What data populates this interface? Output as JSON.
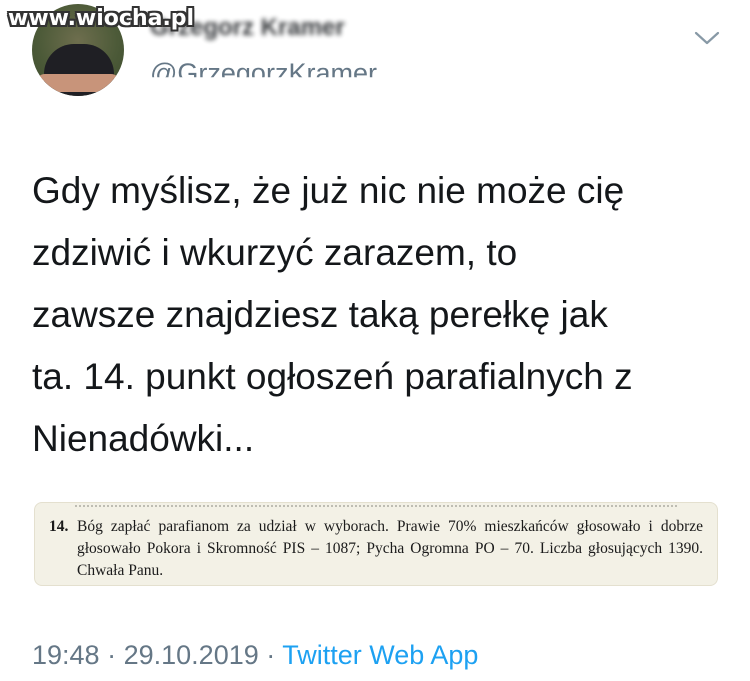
{
  "watermark": "www.wiocha.pl",
  "author": {
    "display_name": "Grzegorz Kramer",
    "handle": "@GrzegorzKramer"
  },
  "tweet": {
    "text": "Gdy myślisz, że już nic nie może cię\nzdziwić i wkurzyć zarazem, to\nzawsze znajdziesz taką perełkę jak\nta. 14. punkt ogłoszeń parafialnych z\nNienadówki..."
  },
  "clipping": {
    "number": "14.",
    "text": "Bóg zapłać parafianom za udział w wyborach. Prawie 70% mieszkańców głosowało i dobrze głosowało Pokora i Skromność PIS – 1087; Pycha Ogromna PO – 70. Liczba głosujących 1390. Chwała Panu."
  },
  "meta": {
    "time": "19:48",
    "separator": "·",
    "date": "29.10.2019",
    "source": "Twitter Web App"
  },
  "colors": {
    "text": "#14171a",
    "secondary": "#657786",
    "link": "#1da1f2"
  }
}
